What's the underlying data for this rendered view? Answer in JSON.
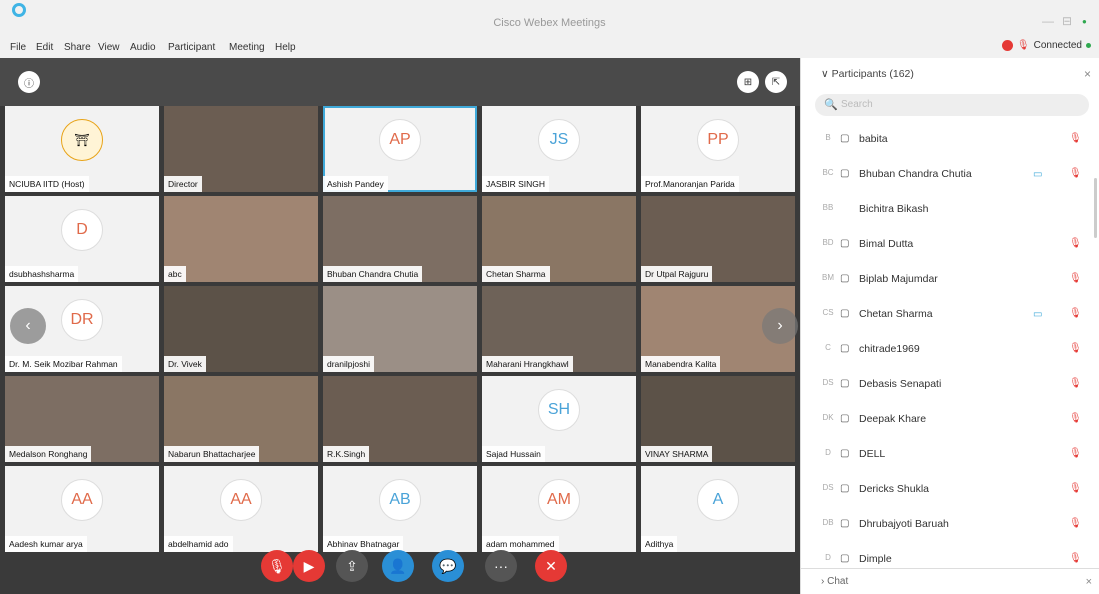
{
  "window": {
    "title": "Cisco Webex Meetings",
    "minimize": "—",
    "maximize": "⊟",
    "close": "●"
  },
  "menu": [
    "File",
    "Edit",
    "Share",
    "View",
    "Audio",
    "Participant",
    "Meeting",
    "Help"
  ],
  "status": {
    "connection": "Connected"
  },
  "tiles": [
    {
      "label": "NCIUBA IITD (Host)",
      "initials": "",
      "photo": false,
      "logo": true
    },
    {
      "label": "Director",
      "initials": "",
      "photo": true
    },
    {
      "label": "Ashish Pandey",
      "initials": "AP",
      "photo": false,
      "highlight": true
    },
    {
      "label": "JASBIR SINGH",
      "initials": "JS",
      "photo": false
    },
    {
      "label": "Prof.Manoranjan Parida",
      "initials": "PP",
      "photo": false
    },
    {
      "label": "dsubhashsharma",
      "initials": "D",
      "photo": false
    },
    {
      "label": "abc",
      "initials": "",
      "photo": true
    },
    {
      "label": "Bhuban Chandra Chutia",
      "initials": "",
      "photo": true
    },
    {
      "label": "Chetan Sharma",
      "initials": "",
      "photo": true
    },
    {
      "label": "Dr Utpal Rajguru",
      "initials": "",
      "photo": true
    },
    {
      "label": "Dr. M. Seik Mozibar Rahman",
      "initials": "DR",
      "photo": false
    },
    {
      "label": "Dr. Vivek",
      "initials": "",
      "photo": true
    },
    {
      "label": "dranilpjoshi",
      "initials": "",
      "photo": true
    },
    {
      "label": "Maharani Hrangkhawl",
      "initials": "",
      "photo": true
    },
    {
      "label": "Manabendra Kalita",
      "initials": "",
      "photo": true
    },
    {
      "label": "Medalson Ronghang",
      "initials": "",
      "photo": true
    },
    {
      "label": "Nabarun Bhattacharjee",
      "initials": "",
      "photo": true
    },
    {
      "label": "R.K.Singh",
      "initials": "",
      "photo": true
    },
    {
      "label": "Sajad Hussain",
      "initials": "SH",
      "photo": false
    },
    {
      "label": "VINAY SHARMA",
      "initials": "",
      "photo": true
    },
    {
      "label": "Aadesh kumar arya",
      "initials": "AA",
      "photo": false
    },
    {
      "label": "abdelhamid ado",
      "initials": "AA",
      "photo": false
    },
    {
      "label": "Abhinav Bhatnagar",
      "initials": "AB",
      "photo": false
    },
    {
      "label": "adam mohammed",
      "initials": "AM",
      "photo": false
    },
    {
      "label": "Adithya",
      "initials": "A",
      "photo": false
    }
  ],
  "participants_panel": {
    "header": "Participants (162)",
    "search_placeholder": "Search",
    "items": [
      {
        "initials": "B",
        "name": "babita",
        "cam": false
      },
      {
        "initials": "BC",
        "name": "Bhuban Chandra Chutia",
        "cam": true
      },
      {
        "initials": "BB",
        "name": "Bichitra Bikash",
        "cam": false
      },
      {
        "initials": "BD",
        "name": "Bimal Dutta",
        "cam": false
      },
      {
        "initials": "BM",
        "name": "Biplab Majumdar",
        "cam": false
      },
      {
        "initials": "CS",
        "name": "Chetan Sharma",
        "cam": true
      },
      {
        "initials": "C",
        "name": "chitrade1969",
        "cam": false
      },
      {
        "initials": "DS",
        "name": "Debasis Senapati",
        "cam": false
      },
      {
        "initials": "DK",
        "name": "Deepak Khare",
        "cam": false
      },
      {
        "initials": "D",
        "name": "DELL",
        "cam": false
      },
      {
        "initials": "DS",
        "name": "Dericks Shukla",
        "cam": false
      },
      {
        "initials": "DB",
        "name": "Dhrubajyoti Baruah",
        "cam": false
      },
      {
        "initials": "D",
        "name": "Dimple",
        "cam": false
      }
    ],
    "chat_label": "Chat"
  },
  "icons": {
    "mute": "mic-icon",
    "video": "video-icon",
    "share": "share-icon",
    "participants": "participants-icon",
    "chat": "chat-icon",
    "more": "more-icon",
    "leave": "leave-icon"
  }
}
